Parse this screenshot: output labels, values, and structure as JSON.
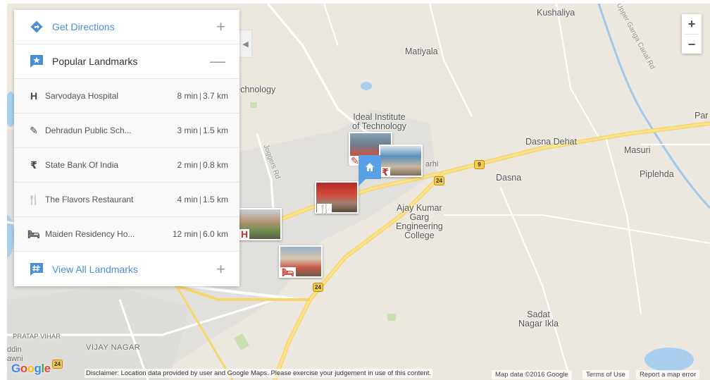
{
  "panel": {
    "directions_label": "Get Directions",
    "directions_toggle": "+",
    "landmarks_title": "Popular Landmarks",
    "landmarks_toggle": "—",
    "view_all_label": "View All Landmarks",
    "view_all_toggle": "+",
    "collapse_glyph": "◀",
    "landmarks": [
      {
        "icon": "hospital-icon",
        "glyph": "H",
        "name": "Sarvodaya Hospital",
        "time": "8 min",
        "dist": "3.7 km"
      },
      {
        "icon": "school-icon",
        "glyph": "✎",
        "name": "Dehradun Public Sch...",
        "time": "3 min",
        "dist": "1.5 km"
      },
      {
        "icon": "bank-icon",
        "glyph": "₹",
        "name": "State Bank Of India",
        "time": "2 min",
        "dist": "0.8 km"
      },
      {
        "icon": "restaurant-icon",
        "glyph": "🍴",
        "name": "The Flavors Restaurant",
        "time": "4 min",
        "dist": "1.5 km"
      },
      {
        "icon": "hotel-icon",
        "glyph": "🛏",
        "name": "Maiden Residency Ho...",
        "time": "12 min",
        "dist": "6.0 km"
      }
    ]
  },
  "map": {
    "zoom_in": "+",
    "zoom_out": "−",
    "labels": {
      "kushaliya": "Kushaliya",
      "matiyala": "Matiyala",
      "ideal_institute": "Ideal Institute\nof Technology",
      "ideal_partial": "el\nTechnology",
      "dasna_dehat": "Dasna Dehat",
      "masuri": "Masuri",
      "piplehda": "Piplehda",
      "dasna": "Dasna",
      "par": "Par",
      "ajay_kumar": "Ajay Kumar\nGarg\nEngineering\nCollege",
      "sadat": "Sadat\nNagar Ikla",
      "vijay_nagar": "VIJAY NAGAR",
      "pratap_vihar": "PRATAP VIHAR",
      "iddin": "ddin\nawni",
      "arhi": "arhi",
      "upper_ganga": "Upper Ganga Canal Rd",
      "joggers": "Joggers Rd"
    },
    "shields": {
      "nh24_a": "24",
      "nh24_b": "24",
      "nh24_c": "24",
      "nh9": "9"
    }
  },
  "footer": {
    "google": "Google",
    "disclaimer": "Disclaimer: Location data provided by user and Google Maps. Please exercise your judgement in use of this content.",
    "map_data": "Map data ©2016 Google",
    "terms": "Terms of Use",
    "report": "Report a map error"
  },
  "colors": {
    "accent": "#4a8fd6",
    "poi": "#c5342e",
    "pin": "#5aa0e6",
    "highway": "#f7c94a"
  }
}
